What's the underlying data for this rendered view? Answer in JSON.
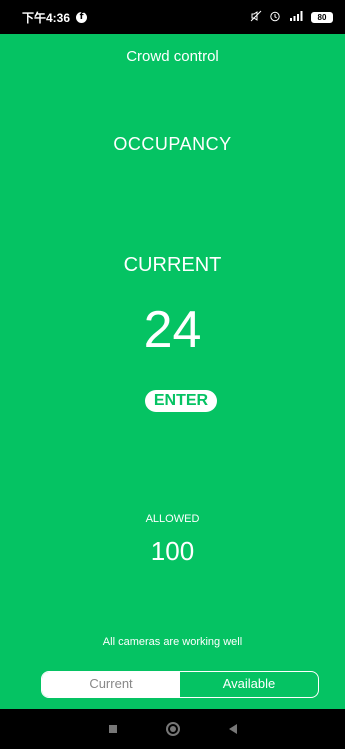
{
  "status_bar": {
    "time": "下午4:36",
    "battery": "80",
    "right_icons": [
      "mute-icon",
      "alarm-icon",
      "signal-icon",
      "battery-icon"
    ]
  },
  "header": {
    "title": "Crowd control"
  },
  "occupancy": {
    "heading": "OCCUPANCY",
    "current_label": "CURRENT",
    "current_value": "24",
    "enter_label": "ENTER",
    "allowed_label": "ALLOWED",
    "allowed_value": "100"
  },
  "footer": {
    "status_text": "All cameras are working well",
    "tabs": [
      {
        "label": "Current",
        "active": true
      },
      {
        "label": "Available",
        "active": false
      }
    ]
  },
  "colors": {
    "background": "#05c363",
    "accent": "#ffffff",
    "system_bars": "#000000"
  }
}
